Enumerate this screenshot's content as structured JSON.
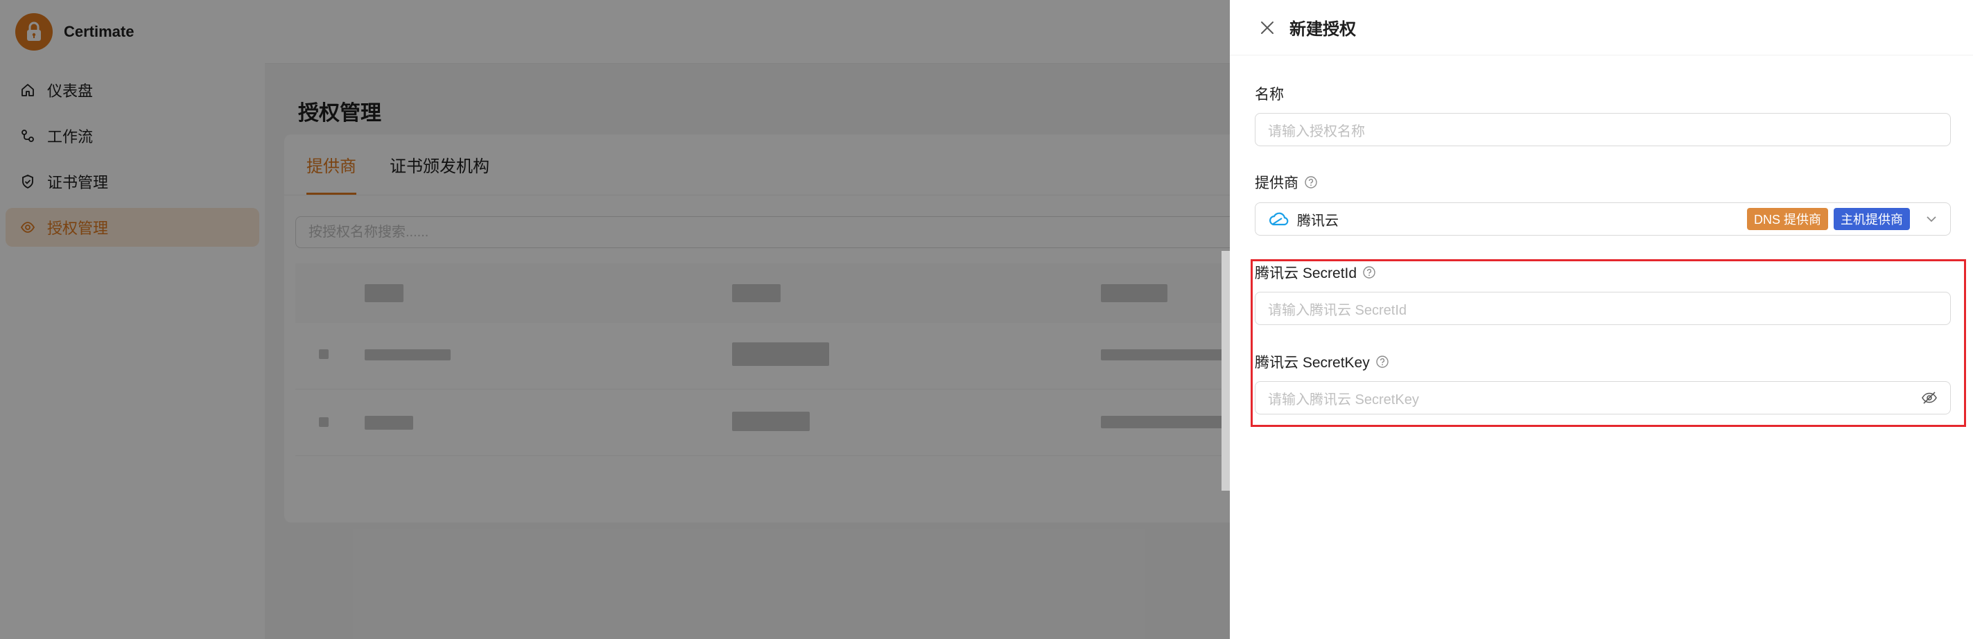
{
  "app": {
    "name": "Certimate",
    "brand_color": "#e07a1f"
  },
  "sidebar": {
    "items": [
      {
        "label": "仪表盘",
        "icon": "home-icon"
      },
      {
        "label": "工作流",
        "icon": "workflow-icon"
      },
      {
        "label": "证书管理",
        "icon": "shield-check-icon"
      },
      {
        "label": "授权管理",
        "icon": "access-icon",
        "active": true
      }
    ]
  },
  "main": {
    "title": "授权管理",
    "tabs": [
      {
        "label": "提供商",
        "active": true
      },
      {
        "label": "证书颁发机构",
        "active": false
      }
    ],
    "search_placeholder": "按授权名称搜索......"
  },
  "drawer": {
    "title": "新建授权",
    "fields": {
      "name": {
        "label": "名称",
        "placeholder": "请输入授权名称"
      },
      "provider": {
        "label": "提供商",
        "value": "腾讯云",
        "tags": [
          "DNS 提供商",
          "主机提供商"
        ],
        "tag_colors": [
          "#dd8a3d",
          "#3a63d6"
        ]
      },
      "secret_id": {
        "label": "腾讯云 SecretId",
        "placeholder": "请输入腾讯云 SecretId"
      },
      "secret_key": {
        "label": "腾讯云 SecretKey",
        "placeholder": "请输入腾讯云 SecretKey"
      }
    },
    "highlight_color": "#e5272d"
  }
}
